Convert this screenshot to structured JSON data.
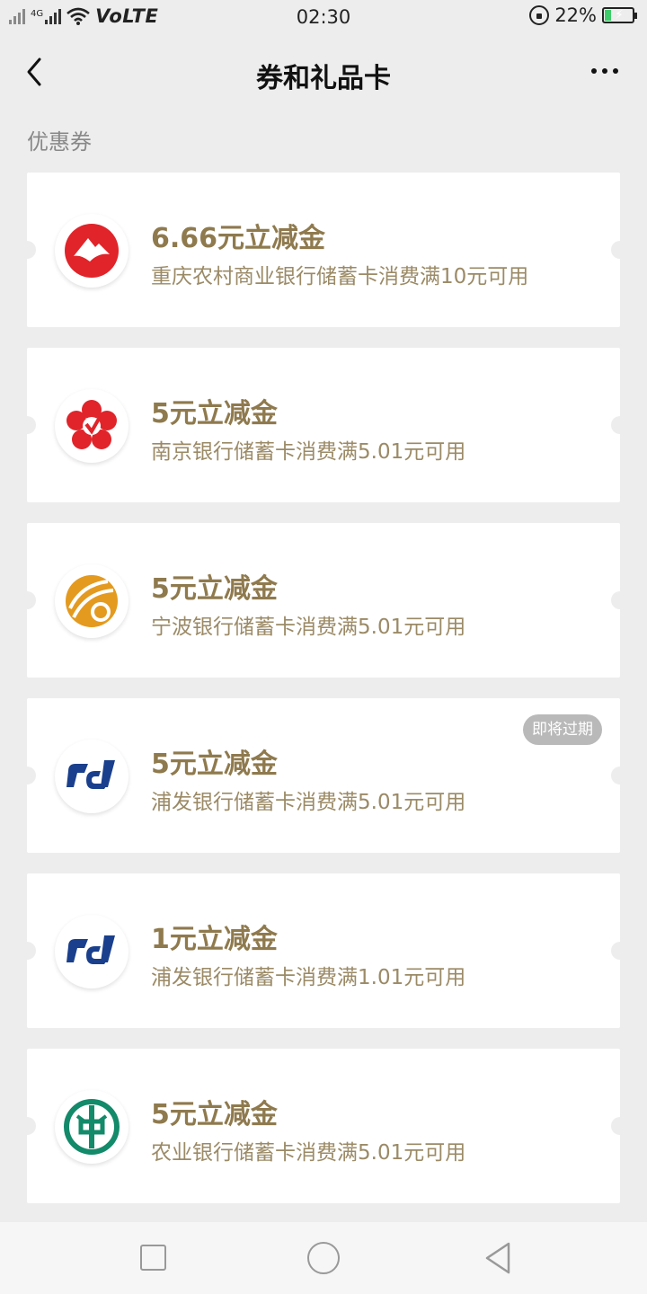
{
  "status_bar": {
    "network_label": "4G",
    "carrier_label": "VoLTE",
    "time": "02:30",
    "battery_percent": "22%",
    "battery_level": 0.22
  },
  "nav": {
    "title": "券和礼品卡"
  },
  "section": {
    "label": "优惠券"
  },
  "coupons": [
    {
      "title": "6.66元立减金",
      "desc": "重庆农村商业银行储蓄卡消费满10元可用",
      "icon": "cqrcb-logo-icon",
      "color": "#e0242a",
      "badge": ""
    },
    {
      "title": "5元立减金",
      "desc": "南京银行储蓄卡消费满5.01元可用",
      "icon": "njbank-logo-icon",
      "color": "#e0242a",
      "badge": ""
    },
    {
      "title": "5元立减金",
      "desc": "宁波银行储蓄卡消费满5.01元可用",
      "icon": "nbbank-logo-icon",
      "color": "#e49a1f",
      "badge": ""
    },
    {
      "title": "5元立减金",
      "desc": "浦发银行储蓄卡消费满5.01元可用",
      "icon": "spdb-logo-icon",
      "color": "#1a3f8c",
      "badge": "即将过期"
    },
    {
      "title": "1元立减金",
      "desc": "浦发银行储蓄卡消费满1.01元可用",
      "icon": "spdb-logo-icon",
      "color": "#1a3f8c",
      "badge": ""
    },
    {
      "title": "5元立减金",
      "desc": "农业银行储蓄卡消费满5.01元可用",
      "icon": "abc-logo-icon",
      "color": "#138a6a",
      "badge": ""
    }
  ],
  "colors": {
    "background": "#ededed",
    "coupon_title": "#8f7a4e",
    "coupon_desc": "#9b8a66",
    "badge_bg": "#b9b9b9"
  }
}
